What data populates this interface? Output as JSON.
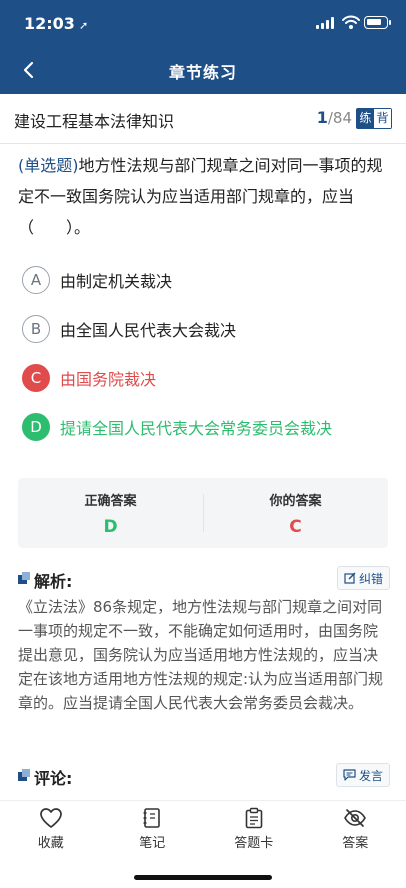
{
  "status_bar": {
    "time": "12:03"
  },
  "nav": {
    "title": "章节练习",
    "back_icon": "chevron-left-icon"
  },
  "subheader": {
    "subject": "建设工程基本法律知识",
    "current": "1",
    "total": "/84",
    "mode_practice": "练",
    "mode_memorize": "背"
  },
  "question": {
    "type": "(单选题)",
    "text": "地方性法规与部门规章之间对同一事项的规定不一致国务院认为应当适用部门规章的，应当（　　）。"
  },
  "options": [
    {
      "letter": "A",
      "text": "由制定机关裁决",
      "state": "normal"
    },
    {
      "letter": "B",
      "text": "由全国人民代表大会裁决",
      "state": "normal"
    },
    {
      "letter": "C",
      "text": "由国务院裁决",
      "state": "wrong"
    },
    {
      "letter": "D",
      "text": "提请全国人民代表大会常务委员会裁决",
      "state": "correct"
    }
  ],
  "answers": {
    "correct_label": "正确答案",
    "correct_value": "D",
    "yours_label": "你的答案",
    "yours_value": "C",
    "correct_color": "#2dbd6e",
    "wrong_color": "#e04b4b"
  },
  "analysis": {
    "title": "解析:",
    "report_label": "纠错",
    "text": "《立法法》86条规定，地方性法规与部门规章之间对同一事项的规定不一致，不能确定如何适用时，由国务院提出意见，国务院认为应当适用地方性法规的，应当决定在该地方适用地方性法规的规定:认为应当适用部门规章的。应当提请全国人民代表大会常务委员会裁决。"
  },
  "comments": {
    "title": "评论:",
    "post_label": "发言"
  },
  "tabbar": [
    {
      "label": "收藏",
      "icon": "heart-icon"
    },
    {
      "label": "笔记",
      "icon": "notebook-icon"
    },
    {
      "label": "答题卡",
      "icon": "clipboard-icon"
    },
    {
      "label": "答案",
      "icon": "eye-off-icon"
    }
  ],
  "colors": {
    "brand": "#1e4f86"
  }
}
